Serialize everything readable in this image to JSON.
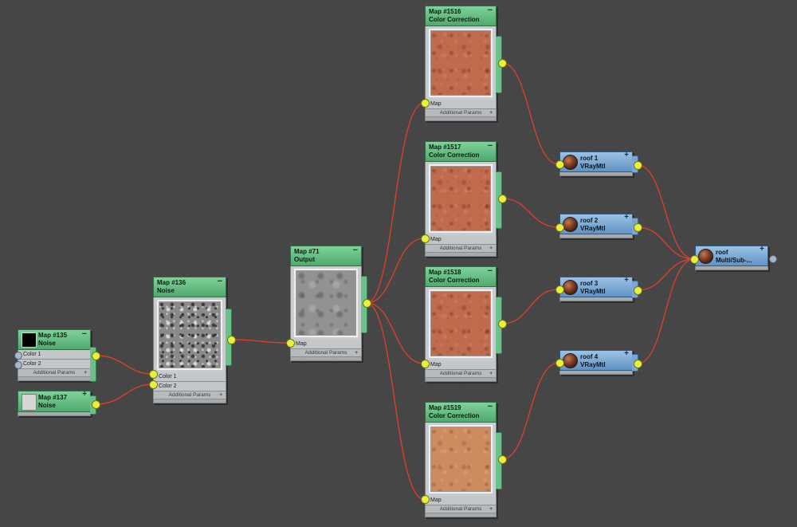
{
  "nodes": {
    "map135": {
      "title": "Map #135",
      "type": "Noise",
      "slots": [
        "Color 1",
        "Color 2"
      ],
      "additional": "Additional Params",
      "swatch_color": "#000000"
    },
    "map137": {
      "title": "Map #137",
      "type": "Noise",
      "swatch_color": "#d6d6d6"
    },
    "map136": {
      "title": "Map #136",
      "type": "Noise",
      "slots": [
        "Color 1",
        "Color 2"
      ],
      "additional": "Additional Params"
    },
    "map71": {
      "title": "Map #71",
      "type": "Output",
      "slots": [
        "Map"
      ],
      "additional": "Additional Params"
    },
    "map1516": {
      "title": "Map #1516",
      "type": "Color Correction",
      "slots": [
        "Map"
      ],
      "additional": "Additional Params"
    },
    "map1517": {
      "title": "Map #1517",
      "type": "Color Correction",
      "slots": [
        "Map"
      ],
      "additional": "Additional Params"
    },
    "map1518": {
      "title": "Map #1518",
      "type": "Color Correction",
      "slots": [
        "Map"
      ],
      "additional": "Additional Params"
    },
    "map1519": {
      "title": "Map #1519",
      "type": "Color Correction",
      "slots": [
        "Map"
      ],
      "additional": "Additional Params"
    },
    "roof1": {
      "title": "roof 1",
      "type": "VRayMtl"
    },
    "roof2": {
      "title": "roof 2",
      "type": "VRayMtl"
    },
    "roof3": {
      "title": "roof 3",
      "type": "VRayMtl"
    },
    "roof4": {
      "title": "roof 4",
      "type": "VRayMtl"
    },
    "roof": {
      "title": "roof",
      "type": "Multi/Sub-..."
    }
  },
  "symbols": {
    "collapse": "−",
    "expand": "+"
  },
  "colors": {
    "canvas": "#464646",
    "map_header": "#5fb97d",
    "material_header": "#7aa6cf",
    "wire": "#e0402a",
    "socket": "#e8f03a"
  }
}
